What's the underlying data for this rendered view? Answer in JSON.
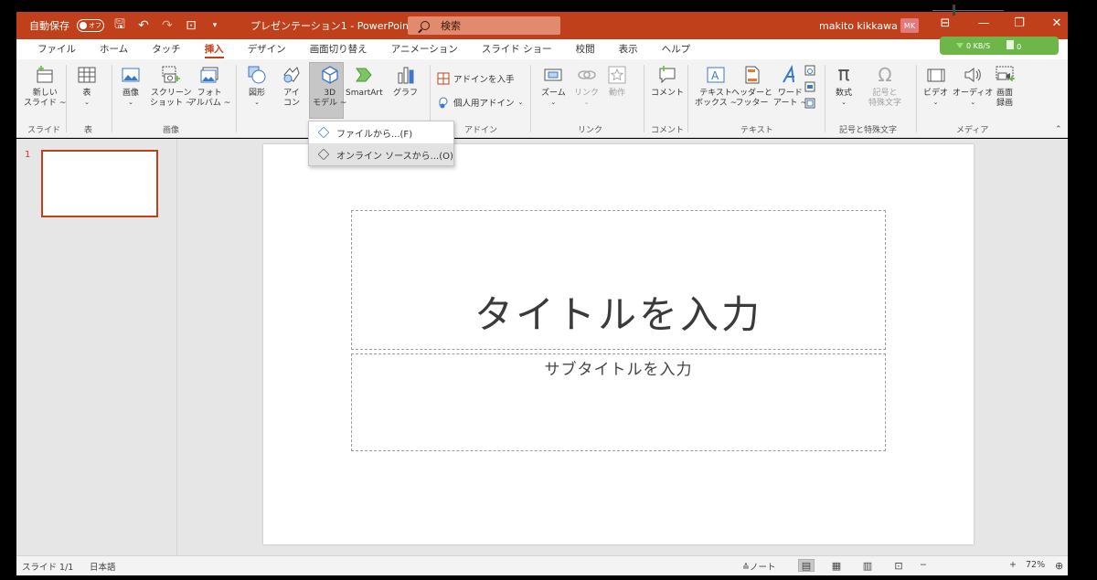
{
  "titlebar": {
    "autosave_label": "自動保存",
    "autosave_toggle": "オフ",
    "doc_title": "プレゼンテーション1  -  PowerPoint",
    "search_placeholder": "検索",
    "user_name": "makito kikkawa",
    "user_initials": "MK"
  },
  "network_monitor": {
    "speed": "0 KB/S",
    "count": "0"
  },
  "tabs": [
    {
      "label": "ファイル"
    },
    {
      "label": "ホーム"
    },
    {
      "label": "タッチ"
    },
    {
      "label": "挿入",
      "active": true
    },
    {
      "label": "デザイン"
    },
    {
      "label": "画面切り替え"
    },
    {
      "label": "アニメーション"
    },
    {
      "label": "スライド ショー"
    },
    {
      "label": "校閲"
    },
    {
      "label": "表示"
    },
    {
      "label": "ヘルプ"
    }
  ],
  "ribbon": {
    "new_slide": [
      "新しい",
      "スライド ~"
    ],
    "table": "表",
    "image": "画像",
    "screenshot": [
      "スクリーン",
      "ショット ~"
    ],
    "photo_album": [
      "フォト",
      "アルバム ~"
    ],
    "shapes": "図形",
    "icons": [
      "アイ",
      "コン"
    ],
    "model3d": [
      "3D",
      "モデル ~"
    ],
    "smartart": "SmartArt",
    "chart": "グラフ",
    "get_addins": "アドインを入手",
    "my_addins": "個人用アドイン",
    "zoom": "ズーム",
    "link": "リンク",
    "action": "動作",
    "comment": "コメント",
    "textbox": [
      "テキスト",
      "ボックス ~"
    ],
    "header_footer": [
      "ヘッダーと",
      "フッター"
    ],
    "wordart": [
      "ワード",
      "アート ~"
    ],
    "equation": "数式",
    "symbol": [
      "記号と",
      "特殊文字"
    ],
    "video": "ビデオ",
    "audio": "オーディオ",
    "screen_record": [
      "画面",
      "録画"
    ],
    "groups": {
      "slides": "スライド",
      "table": "表",
      "images": "画像",
      "addins": "アドイン",
      "links": "リンク",
      "comments": "コメント",
      "text": "テキスト",
      "symbols": "記号と特殊文字",
      "media": "メディア"
    }
  },
  "dropdown": {
    "from_file": "ファイルから...(F)",
    "from_online": "オンライン ソースから...(O)"
  },
  "thumbnail": {
    "number": "1"
  },
  "slide": {
    "title_placeholder": "タイトルを入力",
    "subtitle_placeholder": "サブタイトルを入力"
  },
  "statusbar": {
    "slide_counter": "スライド 1/1",
    "language": "日本語",
    "notes": "ノート",
    "zoom_level": "72%",
    "zoom_minus": "−",
    "zoom_plus": "+"
  },
  "colors": {
    "accent": "#c1401c",
    "ribbon_bg": "#f3f3f3",
    "workspace_bg": "#e6e6e6"
  }
}
